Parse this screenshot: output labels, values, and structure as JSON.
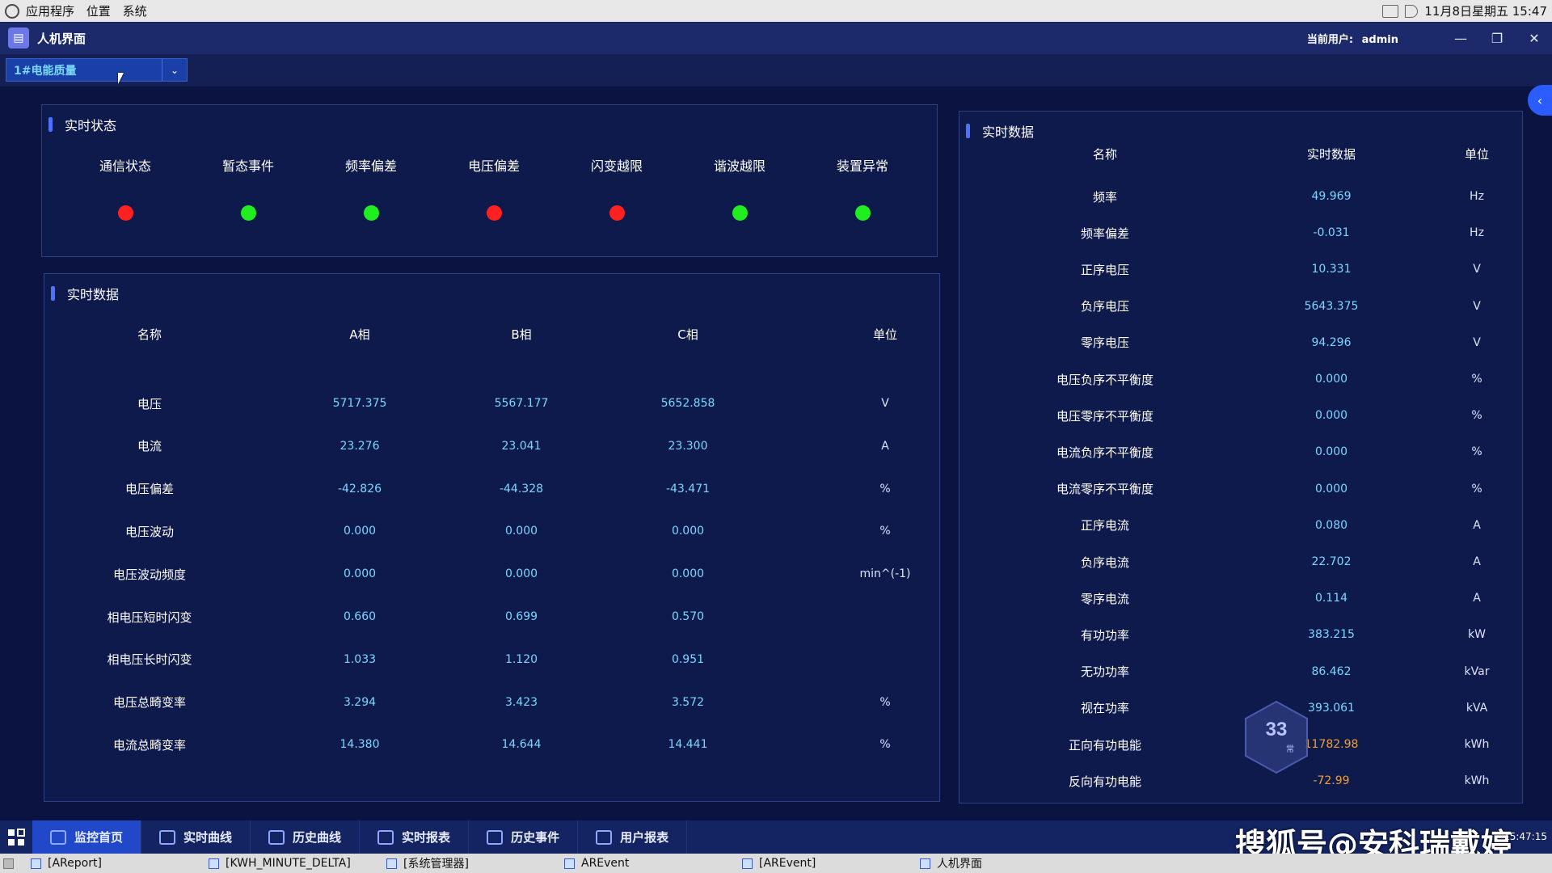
{
  "sysbar": {
    "menu": [
      "应用程序",
      "位置",
      "系统"
    ],
    "datetime": "11月8日星期五 15:47"
  },
  "window": {
    "title": "人机界面",
    "user_label": "当前用户:",
    "user_name": "admin"
  },
  "toolbar": {
    "selected_device": "1#电能质量"
  },
  "status": {
    "title": "实时状态",
    "items": [
      {
        "label": "通信状态",
        "color": "#ff2020"
      },
      {
        "label": "暂态事件",
        "color": "#20ee20"
      },
      {
        "label": "频率偏差",
        "color": "#20ee20"
      },
      {
        "label": "电压偏差",
        "color": "#ff2020"
      },
      {
        "label": "闪变越限",
        "color": "#ff2020"
      },
      {
        "label": "谐波越限",
        "color": "#20ee20"
      },
      {
        "label": "装置异常",
        "color": "#20ee20"
      }
    ]
  },
  "phase_table": {
    "title": "实时数据",
    "headers": [
      "名称",
      "A相",
      "B相",
      "C相",
      "单位"
    ],
    "rows": [
      {
        "name": "电压",
        "a": "5717.375",
        "b": "5567.177",
        "c": "5652.858",
        "unit": "V"
      },
      {
        "name": "电流",
        "a": "23.276",
        "b": "23.041",
        "c": "23.300",
        "unit": "A"
      },
      {
        "name": "电压偏差",
        "a": "-42.826",
        "b": "-44.328",
        "c": "-43.471",
        "unit": "%"
      },
      {
        "name": "电压波动",
        "a": "0.000",
        "b": "0.000",
        "c": "0.000",
        "unit": "%"
      },
      {
        "name": "电压波动频度",
        "a": "0.000",
        "b": "0.000",
        "c": "0.000",
        "unit": "min^(-1)"
      },
      {
        "name": "相电压短时闪变",
        "a": "0.660",
        "b": "0.699",
        "c": "0.570",
        "unit": ""
      },
      {
        "name": "相电压长时闪变",
        "a": "1.033",
        "b": "1.120",
        "c": "0.951",
        "unit": ""
      },
      {
        "name": "电压总畸变率",
        "a": "3.294",
        "b": "3.423",
        "c": "3.572",
        "unit": "%"
      },
      {
        "name": "电流总畸变率",
        "a": "14.380",
        "b": "14.644",
        "c": "14.441",
        "unit": "%"
      }
    ]
  },
  "summary_table": {
    "title": "实时数据",
    "headers": [
      "名称",
      "实时数据",
      "单位"
    ],
    "rows": [
      {
        "name": "频率",
        "value": "49.969",
        "unit": "Hz"
      },
      {
        "name": "频率偏差",
        "value": "-0.031",
        "unit": "Hz"
      },
      {
        "name": "正序电压",
        "value": "10.331",
        "unit": "V"
      },
      {
        "name": "负序电压",
        "value": "5643.375",
        "unit": "V"
      },
      {
        "name": "零序电压",
        "value": "94.296",
        "unit": "V"
      },
      {
        "name": "电压负序不平衡度",
        "value": "0.000",
        "unit": "%"
      },
      {
        "name": "电压零序不平衡度",
        "value": "0.000",
        "unit": "%"
      },
      {
        "name": "电流负序不平衡度",
        "value": "0.000",
        "unit": "%"
      },
      {
        "name": "电流零序不平衡度",
        "value": "0.000",
        "unit": "%"
      },
      {
        "name": "正序电流",
        "value": "0.080",
        "unit": "A"
      },
      {
        "name": "负序电流",
        "value": "22.702",
        "unit": "A"
      },
      {
        "name": "零序电流",
        "value": "0.114",
        "unit": "A"
      },
      {
        "name": "有功功率",
        "value": "383.215",
        "unit": "kW"
      },
      {
        "name": "无功功率",
        "value": "86.462",
        "unit": "kVar"
      },
      {
        "name": "视在功率",
        "value": "393.061",
        "unit": "kVA"
      },
      {
        "name": "正向有功电能",
        "value": "11782.98",
        "unit": "kWh"
      },
      {
        "name": "反向有功电能",
        "value": "-72.99",
        "unit": "kWh"
      }
    ]
  },
  "badge": {
    "number": "33",
    "caption": "常"
  },
  "bottom_nav": {
    "tabs": [
      "监控首页",
      "实时曲线",
      "历史曲线",
      "实时报表",
      "历史事件",
      "用户报表"
    ],
    "active": 0
  },
  "watermark": "搜狐号@安科瑞戴婷",
  "clock": "15:47:15",
  "taskbar": {
    "items": [
      "[AReport]",
      "[KWH_MINUTE_DELTA]",
      "[系统管理器]",
      "AREvent",
      "[AREvent]",
      "人机界面"
    ]
  }
}
